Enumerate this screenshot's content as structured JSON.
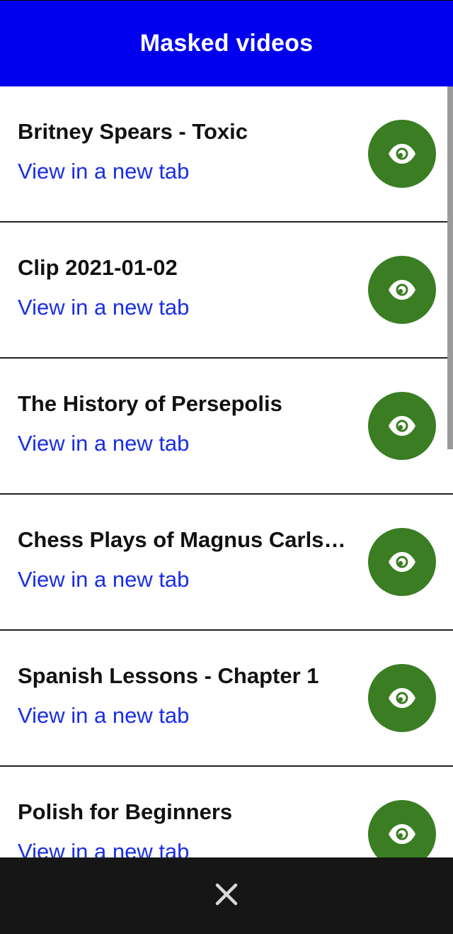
{
  "header": {
    "title": "Masked videos",
    "background": "#0000ee"
  },
  "videos": [
    {
      "title": "Britney Spears - Toxic",
      "link_label": "View in a new tab"
    },
    {
      "title": "Clip 2021-01-02",
      "link_label": "View in a new tab"
    },
    {
      "title": "The History of Persepolis",
      "link_label": "View in a new tab"
    },
    {
      "title": "Chess Plays of Magnus Carlsen",
      "link_label": "View in a new tab"
    },
    {
      "title": "Spanish Lessons - Chapter 1",
      "link_label": "View in a new tab"
    },
    {
      "title": "Polish for Beginners",
      "link_label": "View in a new tab"
    }
  ],
  "view_button": {
    "icon": "eye-icon",
    "color": "#3a7d23"
  },
  "link_color": "#1a2ee6",
  "footer": {
    "icon": "close-icon",
    "background": "#161616"
  }
}
